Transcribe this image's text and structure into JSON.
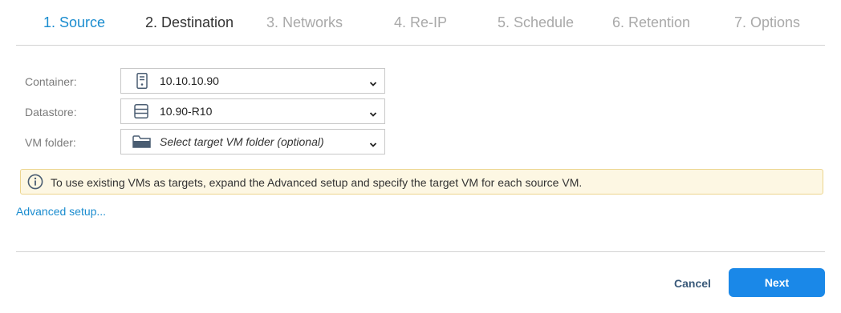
{
  "steps": [
    {
      "label": "1. Source",
      "state": "done"
    },
    {
      "label": "2. Destination",
      "state": "active"
    },
    {
      "label": "3. Networks",
      "state": "pending"
    },
    {
      "label": "4. Re-IP",
      "state": "pending"
    },
    {
      "label": "5. Schedule",
      "state": "pending"
    },
    {
      "label": "6. Retention",
      "state": "pending"
    },
    {
      "label": "7. Options",
      "state": "pending"
    }
  ],
  "form": {
    "container": {
      "label": "Container:",
      "value": "10.10.10.90",
      "icon": "server-icon"
    },
    "datastore": {
      "label": "Datastore:",
      "value": "10.90-R10",
      "icon": "datastore-icon"
    },
    "vm_folder": {
      "label": "VM folder:",
      "placeholder": "Select target VM folder (optional)",
      "icon": "folder-icon"
    }
  },
  "banner": {
    "icon": "info-icon",
    "message": "To use existing VMs as targets, expand the Advanced setup and specify the target VM for each source VM."
  },
  "advanced_link": "Advanced setup...",
  "footer": {
    "cancel_label": "Cancel",
    "next_label": "Next"
  },
  "colors": {
    "accent": "#1a8ccf",
    "primary_button": "#1a88e8",
    "banner_bg": "#fdf7e3",
    "banner_border": "#ecd58f"
  }
}
